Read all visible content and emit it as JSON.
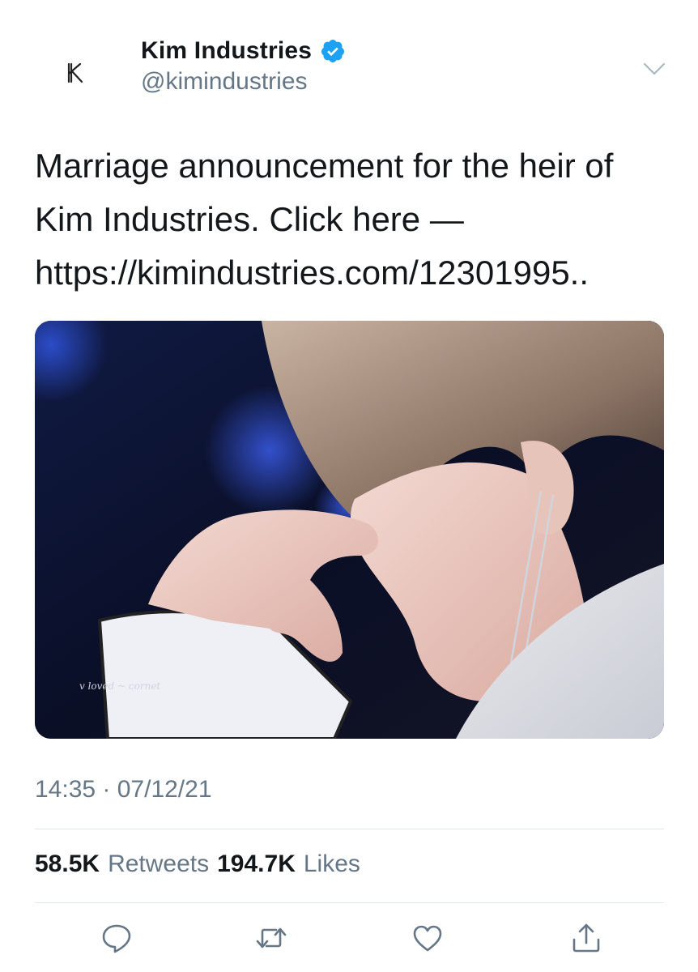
{
  "account": {
    "display_name": "Kim Industries",
    "handle": "@kimindustries",
    "verified": true,
    "avatar_icon": "k-logo-icon"
  },
  "tweet": {
    "text": "Marriage announcement for the heir of Kim Industries. Click here — https://kimindustries.com/12301995..",
    "timestamp": "14:35 · 07/12/21",
    "image_watermark": "v loved ~ cornet"
  },
  "stats": {
    "retweets_count": "58.5K",
    "retweets_label": "Retweets",
    "likes_count": "194.7K",
    "likes_label": "Likes"
  },
  "actions": [
    {
      "name": "reply",
      "icon": "speech-bubble-icon"
    },
    {
      "name": "retweet",
      "icon": "retweet-arrows-icon"
    },
    {
      "name": "like",
      "icon": "heart-icon"
    },
    {
      "name": "share",
      "icon": "share-upload-icon"
    }
  ],
  "colors": {
    "verified_badge": "#1da1f2",
    "secondary_text": "#657786",
    "primary_text": "#14171a",
    "divider": "#e1e8ed"
  }
}
